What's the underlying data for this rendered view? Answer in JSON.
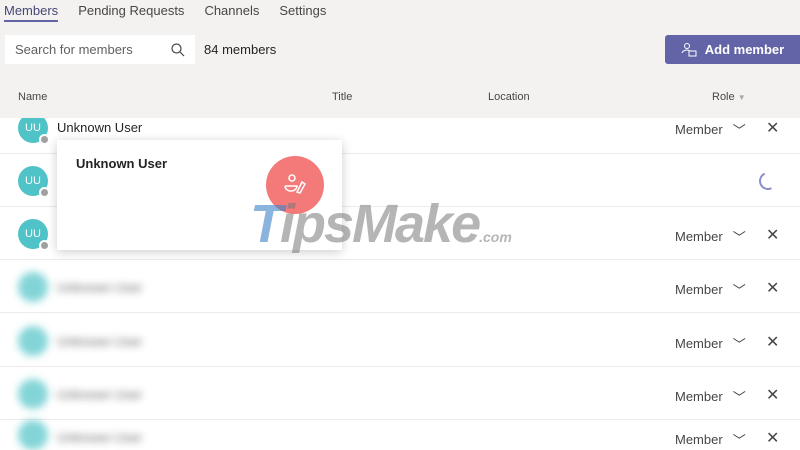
{
  "tabs": [
    "Members",
    "Pending Requests",
    "Channels",
    "Settings"
  ],
  "search": {
    "placeholder": "Search for members"
  },
  "member_count": "84 members",
  "add_member_label": "Add member",
  "columns": {
    "name": "Name",
    "title": "Title",
    "location": "Location",
    "role": "Role"
  },
  "rows": [
    {
      "initials": "UU",
      "name": "Unknown User",
      "role": "Member"
    },
    {
      "initials": "UU",
      "name": "",
      "role": ""
    },
    {
      "initials": "UU",
      "name": "",
      "role": "Member"
    },
    {
      "initials": "",
      "name": "Unknown User",
      "role": "Member"
    },
    {
      "initials": "",
      "name": "Unknown User",
      "role": "Member"
    },
    {
      "initials": "",
      "name": "Unknown User",
      "role": "Member"
    },
    {
      "initials": "",
      "name": "Unknown User",
      "role": "Member"
    }
  ],
  "popup": {
    "name": "Unknown User"
  },
  "watermark": {
    "brand": "TipsMake",
    "tld": ".com"
  },
  "colors": {
    "accent": "#6264a7",
    "avatar": "#4fc3c7",
    "call": "#f47a7a"
  }
}
